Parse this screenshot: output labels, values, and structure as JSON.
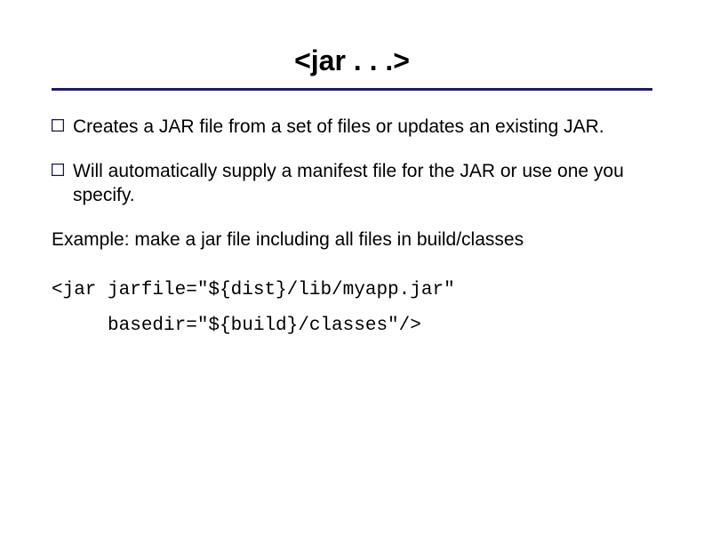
{
  "title": "<jar . . .>",
  "bullets": [
    {
      "text": "Creates a JAR file from a set of files or updates an existing JAR."
    },
    {
      "text": "Will automatically supply a manifest file for the JAR or use one you specify."
    }
  ],
  "example_label": "Example: make a jar file including all files in build/classes",
  "code": "<jar jarfile=\"${dist}/lib/myapp.jar\"\n     basedir=\"${build}/classes\"/>",
  "colors": {
    "rule": "#1b1b66",
    "bullet": "#161650"
  }
}
